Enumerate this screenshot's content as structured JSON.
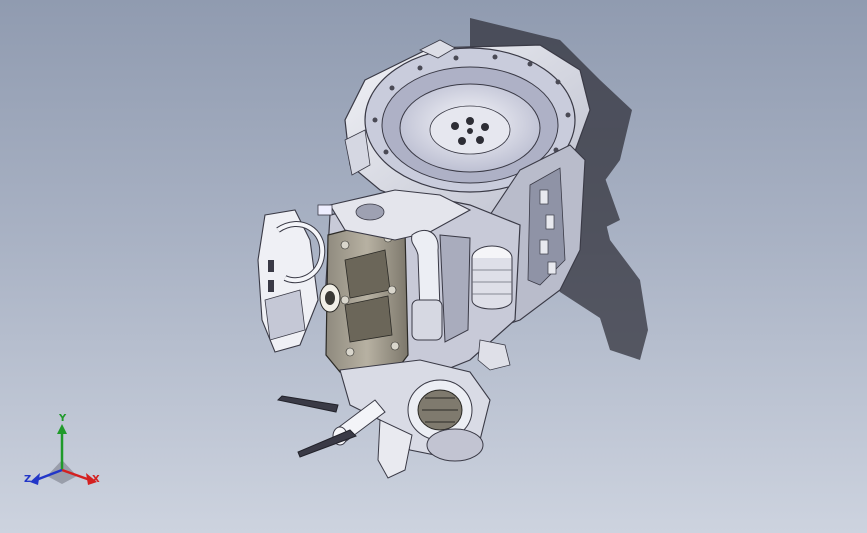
{
  "viewport": {
    "background_top": "#909bb0",
    "background_bottom": "#cdd3df",
    "model": "engine-assembly"
  },
  "triad": {
    "x_label": "X",
    "y_label": "Y",
    "z_label": "Z",
    "x_color": "#d42020",
    "y_color": "#1f9a2a",
    "z_color": "#2236c8"
  }
}
